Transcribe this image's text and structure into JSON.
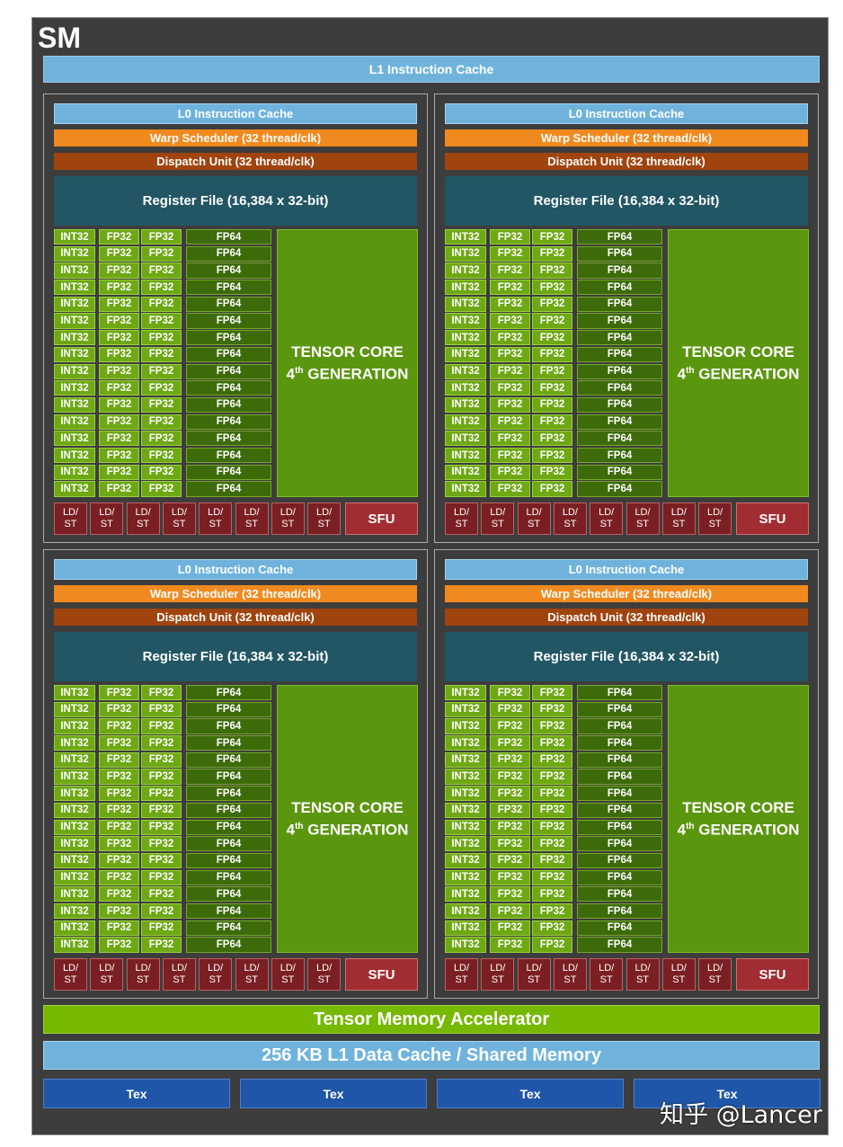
{
  "sm_title": "SM",
  "l1_instruction_cache": "L1 Instruction Cache",
  "processing_block": {
    "l0_cache": "L0 Instruction Cache",
    "warp_scheduler": "Warp Scheduler (32 thread/clk)",
    "dispatch_unit": "Dispatch Unit (32 thread/clk)",
    "register_file": "Register File (16,384 x 32-bit)",
    "int32_label": "INT32",
    "fp32_label": "FP32",
    "fp64_label": "FP64",
    "core_rows": 16,
    "tensor_core_line1": "TENSOR CORE",
    "tensor_core_line2_num": "4",
    "tensor_core_line2_sup": "th",
    "tensor_core_line2_rest": " GENERATION",
    "ldst_top": "LD/",
    "ldst_bottom": "ST",
    "ldst_units": 8,
    "sfu": "SFU"
  },
  "tensor_memory_accelerator": "Tensor Memory Accelerator",
  "l1_data_cache": "256 KB L1 Data Cache / Shared Memory",
  "tex_units": [
    "Tex",
    "Tex",
    "Tex",
    "Tex"
  ],
  "watermark": "知乎 @Lancer",
  "colors": {
    "background": "#3d3d3d",
    "cache_blue": "#6fb3dd",
    "warp_orange": "#f08a1f",
    "dispatch_brown": "#a0440f",
    "register_teal": "#225664",
    "core_green": "#6ea814",
    "fp64_green": "#3d6b0a",
    "tensor_green": "#5b960f",
    "ldst_red": "#7a1f23",
    "tma_green": "#76b900",
    "tex_blue": "#1f56a8"
  }
}
